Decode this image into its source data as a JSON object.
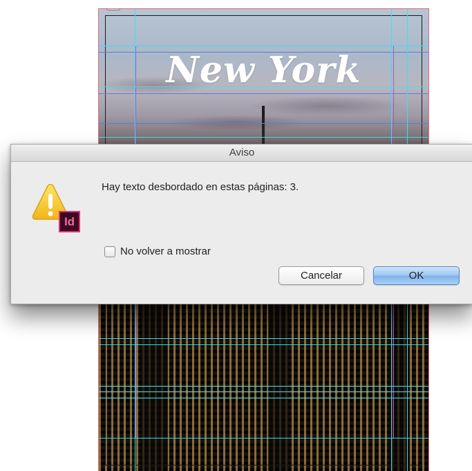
{
  "document": {
    "title_text": "New York"
  },
  "dialog": {
    "title": "Aviso",
    "message": "Hay texto desbordado en estas páginas: 3.",
    "icon": "warning-triangle-icon",
    "app_badge": "Id",
    "checkbox": {
      "label": "No volver a mostrar",
      "checked": false
    },
    "buttons": {
      "cancel": "Cancelar",
      "ok": "OK"
    }
  },
  "colors": {
    "guide_cyan": "#35e3f0",
    "margin_magenta": "#b44cd9",
    "warning_yellow": "#f7cd2e",
    "indesign_pink": "#e3307b",
    "ok_button_blue": "#8fbdee"
  }
}
